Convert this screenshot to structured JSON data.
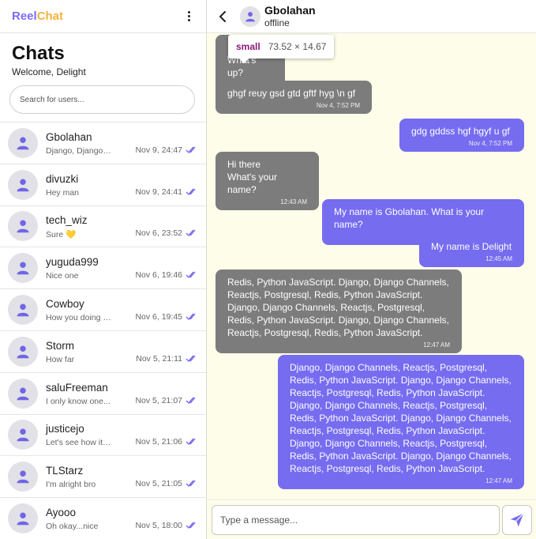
{
  "brand": {
    "part1": "Reel",
    "part2": "Chat"
  },
  "sidebar": {
    "title": "Chats",
    "welcome": "Welcome, Delight",
    "search_placeholder": "Search for users...",
    "chats": [
      {
        "name": "Gbolahan",
        "preview": "Django, Django Channels",
        "time": "Nov 9, 24:47"
      },
      {
        "name": "divuzki",
        "preview": "Hey man",
        "time": "Nov 9, 24:41"
      },
      {
        "name": "tech_wiz",
        "preview": "Sure 💛",
        "time": "Nov 6, 23:52"
      },
      {
        "name": "yuguda999",
        "preview": "Nice one",
        "time": "Nov 6, 19:46"
      },
      {
        "name": "Cowboy",
        "preview": "How you doing bro",
        "time": "Nov 6, 19:45"
      },
      {
        "name": "Storm",
        "preview": "How far",
        "time": "Nov 5, 21:11"
      },
      {
        "name": "saluFreeman",
        "preview": "I only know one...",
        "time": "Nov 5, 21:07"
      },
      {
        "name": "justicejo",
        "preview": "Let's see how it goes",
        "time": "Nov 5, 21:06"
      },
      {
        "name": "TLStarz",
        "preview": "I'm alright bro",
        "time": "Nov 5, 21:05"
      },
      {
        "name": "Ayooo",
        "preview": "Oh okay...nice",
        "time": "Nov 5, 18:00"
      }
    ]
  },
  "chat": {
    "contact_name": "Gbolahan",
    "status": "offline",
    "input_placeholder": "Type a message...",
    "tooltip": {
      "tag": "small",
      "size": "73.52 × 14.67"
    },
    "messages": [
      {
        "dir": "in",
        "lines": [
          "Hi",
          "What's up?"
        ],
        "time": "Nov 4, 4:19 PM"
      },
      {
        "dir": "in",
        "lines": [
          "ghgf reuy gsd gtd gftf hyg \\n gf"
        ],
        "time": "Nov 4, 7:52 PM"
      },
      {
        "dir": "out",
        "lines": [
          "gdg gddss hgf hgyf u gf"
        ],
        "time": "Nov 4, 7:52 PM"
      },
      {
        "dir": "in",
        "lines": [
          "Hi there",
          "What's your name?"
        ],
        "time": "12:43 AM"
      },
      {
        "dir": "out",
        "lines": [
          "My name is Gbolahan. What is your name?"
        ],
        "time": "12:45 AM"
      },
      {
        "dir": "out",
        "lines": [
          "My name is Delight"
        ],
        "time": "12:45 AM"
      },
      {
        "dir": "in",
        "lines": [
          "Redis, Python JavaScript. Django, Django Channels, Reactjs, Postgresql, Redis, Python JavaScript. Django, Django Channels, Reactjs, Postgresql, Redis, Python JavaScript. Django, Django Channels, Reactjs, Postgresql, Redis, Python JavaScript."
        ],
        "time": "12:47 AM"
      },
      {
        "dir": "out",
        "lines": [
          "Django, Django Channels, Reactjs, Postgresql, Redis, Python JavaScript. Django, Django Channels, Reactjs, Postgresql, Redis, Python JavaScript. Django, Django Channels, Reactjs, Postgresql, Redis, Python JavaScript. Django, Django Channels, Reactjs, Postgresql, Redis, Python JavaScript. Django, Django Channels, Reactjs, Postgresql, Redis, Python JavaScript. Django, Django Channels, Reactjs, Postgresql, Redis, Python JavaScript."
        ],
        "time": "12:47 AM"
      }
    ]
  },
  "colors": {
    "accent": "#766cf0",
    "incoming": "#7c7c7c",
    "chat_bg": "#fdfdea",
    "brand_yellow": "#f5b33b"
  },
  "icons": {
    "menu": "kebab-menu-icon",
    "back": "back-arrow-icon",
    "avatar": "user-icon",
    "read": "double-check-icon",
    "send": "send-icon"
  }
}
